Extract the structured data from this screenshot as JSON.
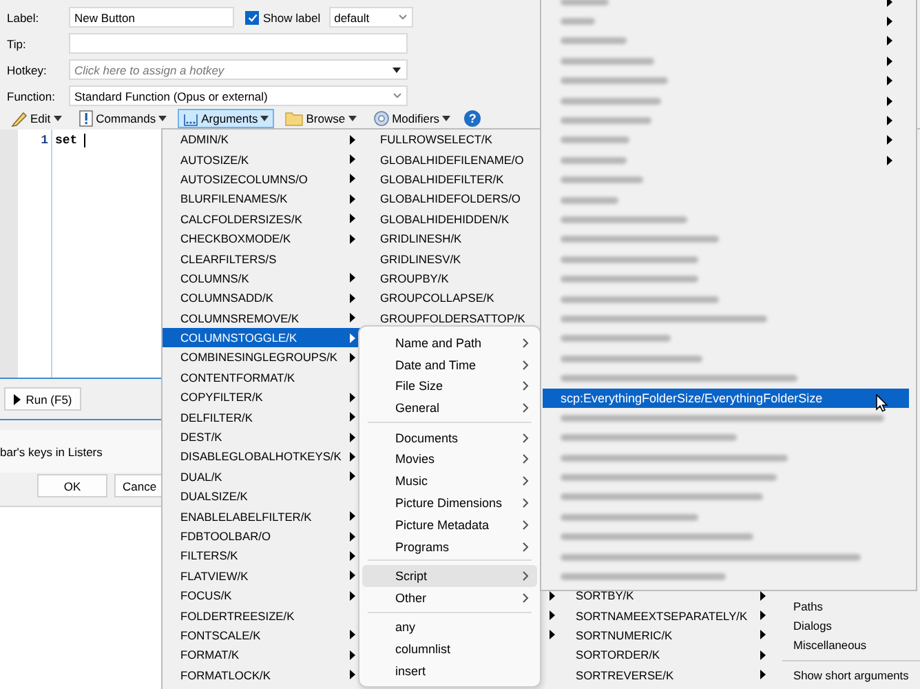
{
  "dialog": {
    "fields": {
      "label": {
        "caption": "Label:",
        "value": "New Button"
      },
      "show_label": {
        "label": "Show label",
        "checked": true
      },
      "label_style": {
        "value": "default"
      },
      "tip": {
        "caption": "Tip:"
      },
      "hotkey": {
        "caption": "Hotkey:",
        "placeholder": "Click here to assign a hotkey"
      },
      "function": {
        "caption": "Function:",
        "value": "Standard Function (Opus or external)"
      }
    },
    "toolbar": [
      {
        "kind": "edit",
        "label": "Edit",
        "pressed": false
      },
      {
        "kind": "commands",
        "label": "Commands",
        "pressed": false
      },
      {
        "kind": "arguments",
        "label": "Arguments",
        "pressed": true
      },
      {
        "kind": "browse",
        "label": "Browse",
        "pressed": false
      },
      {
        "kind": "modifiers",
        "label": "Modifiers",
        "pressed": false
      },
      {
        "kind": "help",
        "label": "?"
      }
    ],
    "editor": {
      "line_number": "1",
      "code": "set"
    },
    "run_button": "Run (F5)",
    "option_text": "bar's keys in Listers",
    "buttons": [
      "OK",
      "Cance"
    ]
  },
  "arguments_menu": {
    "column_1": [
      {
        "label": "ADMIN/K",
        "submenu": true,
        "selected": false
      },
      {
        "label": "AUTOSIZE/K",
        "submenu": true,
        "selected": false
      },
      {
        "label": "AUTOSIZECOLUMNS/O",
        "submenu": true,
        "selected": false
      },
      {
        "label": "BLURFILENAMES/K",
        "submenu": true,
        "selected": false
      },
      {
        "label": "CALCFOLDERSIZES/K",
        "submenu": true,
        "selected": false
      },
      {
        "label": "CHECKBOXMODE/K",
        "submenu": true,
        "selected": false
      },
      {
        "label": "CLEARFILTERS/S",
        "submenu": false,
        "selected": false
      },
      {
        "label": "COLUMNS/K",
        "submenu": true,
        "selected": false
      },
      {
        "label": "COLUMNSADD/K",
        "submenu": true,
        "selected": false
      },
      {
        "label": "COLUMNSREMOVE/K",
        "submenu": true,
        "selected": false
      },
      {
        "label": "COLUMNSTOGGLE/K",
        "submenu": true,
        "selected": true
      },
      {
        "label": "COMBINESINGLEGROUPS/K",
        "submenu": true,
        "selected": false
      },
      {
        "label": "CONTENTFORMAT/K",
        "submenu": false,
        "selected": false
      },
      {
        "label": "COPYFILTER/K",
        "submenu": true,
        "selected": false
      },
      {
        "label": "DELFILTER/K",
        "submenu": true,
        "selected": false
      },
      {
        "label": "DEST/K",
        "submenu": true,
        "selected": false
      },
      {
        "label": "DISABLEGLOBALHOTKEYS/K",
        "submenu": true,
        "selected": false
      },
      {
        "label": "DUAL/K",
        "submenu": true,
        "selected": false
      },
      {
        "label": "DUALSIZE/K",
        "submenu": false,
        "selected": false
      },
      {
        "label": "ENABLELABELFILTER/K",
        "submenu": true,
        "selected": false
      },
      {
        "label": "FDBTOOLBAR/O",
        "submenu": true,
        "selected": false
      },
      {
        "label": "FILTERS/K",
        "submenu": true,
        "selected": false
      },
      {
        "label": "FLATVIEW/K",
        "submenu": true,
        "selected": false
      },
      {
        "label": "FOCUS/K",
        "submenu": true,
        "selected": false
      },
      {
        "label": "FOLDERTREESIZE/K",
        "submenu": false,
        "selected": false
      },
      {
        "label": "FONTSCALE/K",
        "submenu": true,
        "selected": false
      },
      {
        "label": "FORMAT/K",
        "submenu": true,
        "selected": false
      },
      {
        "label": "FORMATLOCK/K",
        "submenu": true,
        "selected": false
      }
    ],
    "column_2": [
      {
        "label": "FULLROWSELECT/K",
        "selected": false
      },
      {
        "label": "GLOBALHIDEFILENAME/O",
        "selected": false
      },
      {
        "label": "GLOBALHIDEFILTER/K",
        "selected": false
      },
      {
        "label": "GLOBALHIDEFOLDERS/O",
        "selected": false
      },
      {
        "label": "GLOBALHIDEHIDDEN/K",
        "selected": false
      },
      {
        "label": "GRIDLINESH/K",
        "selected": false
      },
      {
        "label": "GRIDLINESV/K",
        "selected": false
      },
      {
        "label": "GROUPBY/K",
        "selected": false
      },
      {
        "label": "GROUPCOLLAPSE/K",
        "selected": false
      },
      {
        "label": "GROUPFOLDERSATTOP/K",
        "selected": false
      }
    ],
    "column_2_bottom": [
      {
        "submenu": true
      },
      {
        "submenu": true
      },
      {
        "submenu": true
      },
      {
        "submenu": false
      },
      {
        "submenu": false
      }
    ],
    "column_3": [
      {
        "label": "SORTBY/K",
        "submenu": true,
        "selected": false
      },
      {
        "label": "SORTNAMEEXTSEPARATELY/K",
        "submenu": true,
        "selected": false
      },
      {
        "label": "SORTNUMERIC/K",
        "submenu": true,
        "selected": false
      },
      {
        "label": "SORTORDER/K",
        "submenu": true,
        "selected": false
      },
      {
        "label": "SORTREVERSE/K",
        "submenu": true,
        "selected": false
      }
    ],
    "column_4": [
      {
        "kind": "item",
        "label": "Paths",
        "selected": false
      },
      {
        "kind": "item",
        "label": "Dialogs",
        "selected": false
      },
      {
        "kind": "item",
        "label": "Miscellaneous",
        "selected": false
      },
      {
        "kind": "separator"
      },
      {
        "kind": "item",
        "label": "Show short arguments",
        "selected": false
      }
    ]
  },
  "columns_menu": {
    "items": [
      {
        "kind": "item",
        "label": "Name and Path",
        "submenu": true,
        "selected": false
      },
      {
        "kind": "item",
        "label": "Date and Time",
        "submenu": true,
        "selected": false
      },
      {
        "kind": "item",
        "label": "File Size",
        "submenu": true,
        "selected": false
      },
      {
        "kind": "item",
        "label": "General",
        "submenu": true,
        "selected": false
      },
      {
        "kind": "separator"
      },
      {
        "kind": "item",
        "label": "Documents",
        "submenu": true,
        "selected": false
      },
      {
        "kind": "item",
        "label": "Movies",
        "submenu": true,
        "selected": false
      },
      {
        "kind": "item",
        "label": "Music",
        "submenu": true,
        "selected": false
      },
      {
        "kind": "item",
        "label": "Picture Dimensions",
        "submenu": true,
        "selected": false
      },
      {
        "kind": "item",
        "label": "Picture Metadata",
        "submenu": true,
        "selected": false
      },
      {
        "kind": "item",
        "label": "Programs",
        "submenu": true,
        "selected": false
      },
      {
        "kind": "separator"
      },
      {
        "kind": "item",
        "label": "Script",
        "submenu": true,
        "selected": true
      },
      {
        "kind": "item",
        "label": "Other",
        "submenu": true,
        "selected": false
      },
      {
        "kind": "separator"
      },
      {
        "kind": "item",
        "label": "any",
        "submenu": false,
        "selected": false
      },
      {
        "kind": "item",
        "label": "columnlist",
        "submenu": false,
        "selected": false
      },
      {
        "kind": "item",
        "label": "insert",
        "submenu": false,
        "selected": false
      }
    ]
  },
  "script_menu": {
    "items": [
      {
        "kind": "blurred",
        "submenu": true,
        "selected": false
      },
      {
        "kind": "blurred",
        "submenu": true,
        "selected": false
      },
      {
        "kind": "blurred",
        "submenu": true,
        "selected": false
      },
      {
        "kind": "blurred",
        "submenu": true,
        "selected": false
      },
      {
        "kind": "blurred",
        "submenu": true,
        "selected": false
      },
      {
        "kind": "blurred",
        "submenu": true,
        "selected": false
      },
      {
        "kind": "blurred",
        "submenu": true,
        "selected": false
      },
      {
        "kind": "blurred",
        "submenu": true,
        "selected": false
      },
      {
        "kind": "blurred",
        "submenu": true,
        "selected": false
      },
      {
        "kind": "blurred",
        "submenu": false,
        "selected": false
      },
      {
        "kind": "blurred",
        "submenu": false,
        "selected": false
      },
      {
        "kind": "blurred",
        "submenu": false,
        "selected": false
      },
      {
        "kind": "blurred",
        "submenu": false,
        "selected": false
      },
      {
        "kind": "blurred",
        "submenu": false,
        "selected": false
      },
      {
        "kind": "blurred",
        "submenu": false,
        "selected": false
      },
      {
        "kind": "blurred",
        "submenu": false,
        "selected": false
      },
      {
        "kind": "blurred",
        "submenu": false,
        "selected": false
      },
      {
        "kind": "blurred",
        "submenu": false,
        "selected": false
      },
      {
        "kind": "blurred",
        "submenu": false,
        "selected": false
      },
      {
        "kind": "blurred",
        "submenu": false,
        "selected": false
      },
      {
        "kind": "item",
        "label": "scp:EverythingFolderSize/EverythingFolderSize",
        "submenu": false,
        "selected": true
      },
      {
        "kind": "blurred",
        "submenu": false,
        "selected": false
      },
      {
        "kind": "blurred",
        "submenu": false,
        "selected": false
      },
      {
        "kind": "blurred",
        "submenu": false,
        "selected": false
      },
      {
        "kind": "blurred",
        "submenu": false,
        "selected": false
      },
      {
        "kind": "blurred",
        "submenu": false,
        "selected": false
      },
      {
        "kind": "blurred",
        "submenu": false,
        "selected": false
      },
      {
        "kind": "blurred",
        "submenu": false,
        "selected": false
      },
      {
        "kind": "blurred",
        "submenu": false,
        "selected": false
      },
      {
        "kind": "blurred",
        "submenu": false,
        "selected": false
      }
    ]
  }
}
